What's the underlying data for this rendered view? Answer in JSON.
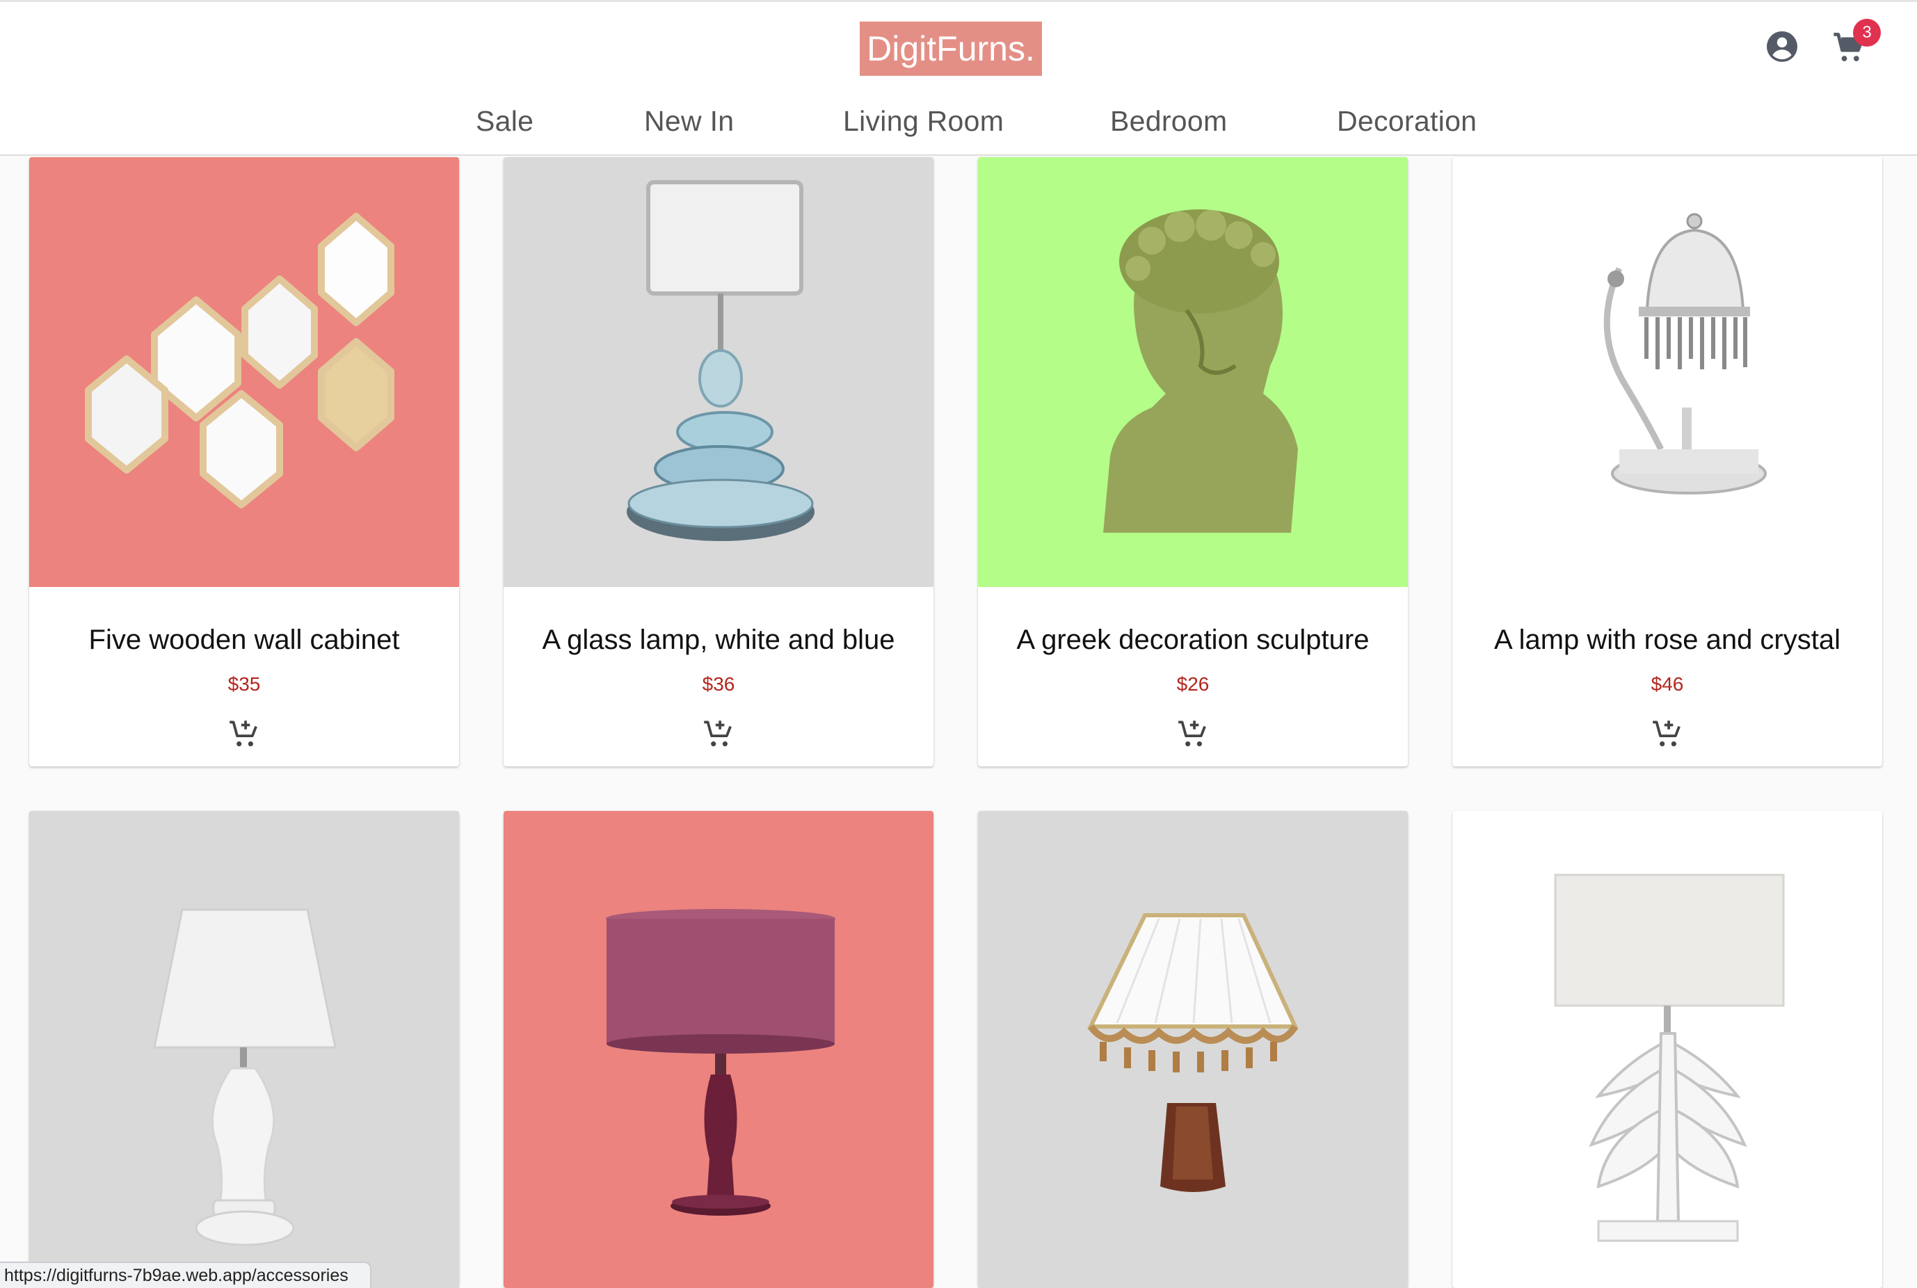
{
  "brand": {
    "name": "DigitFurns.",
    "logo_color": "#e48f86"
  },
  "header": {
    "account_icon": "account-circle-icon",
    "cart_icon": "shopping-cart-icon",
    "cart_count": "3"
  },
  "nav": {
    "items": [
      "Sale",
      "New In",
      "Living Room",
      "Bedroom",
      "Decoration"
    ]
  },
  "products": [
    {
      "title": "Five wooden wall cabinet",
      "price": "$35",
      "bg": "#ec837e",
      "image": "hexagon-wall-shelf"
    },
    {
      "title": "A glass lamp, white and blue",
      "price": "$36",
      "bg": "#d9d9d9",
      "image": "glass-stone-lamp"
    },
    {
      "title": "A greek decoration sculpture",
      "price": "$26",
      "bg": "#b3fd88",
      "image": "greek-bust"
    },
    {
      "title": "A lamp with rose and crystal",
      "price": "$46",
      "bg": "#ffffff",
      "image": "crystal-lamp"
    },
    {
      "title": "",
      "price": "",
      "bg": "#d9d9d9",
      "image": "white-table-lamp"
    },
    {
      "title": "",
      "price": "",
      "bg": "#ec837e",
      "image": "purple-table-lamp"
    },
    {
      "title": "",
      "price": "",
      "bg": "#d9d9d9",
      "image": "fringe-lamp"
    },
    {
      "title": "",
      "price": "",
      "bg": "#ffffff",
      "image": "leaf-lamp"
    }
  ],
  "add_to_cart_icon": "add-shopping-cart-icon",
  "status_bar": {
    "url": "https://digitfurns-7b9ae.web.app/accessories"
  }
}
